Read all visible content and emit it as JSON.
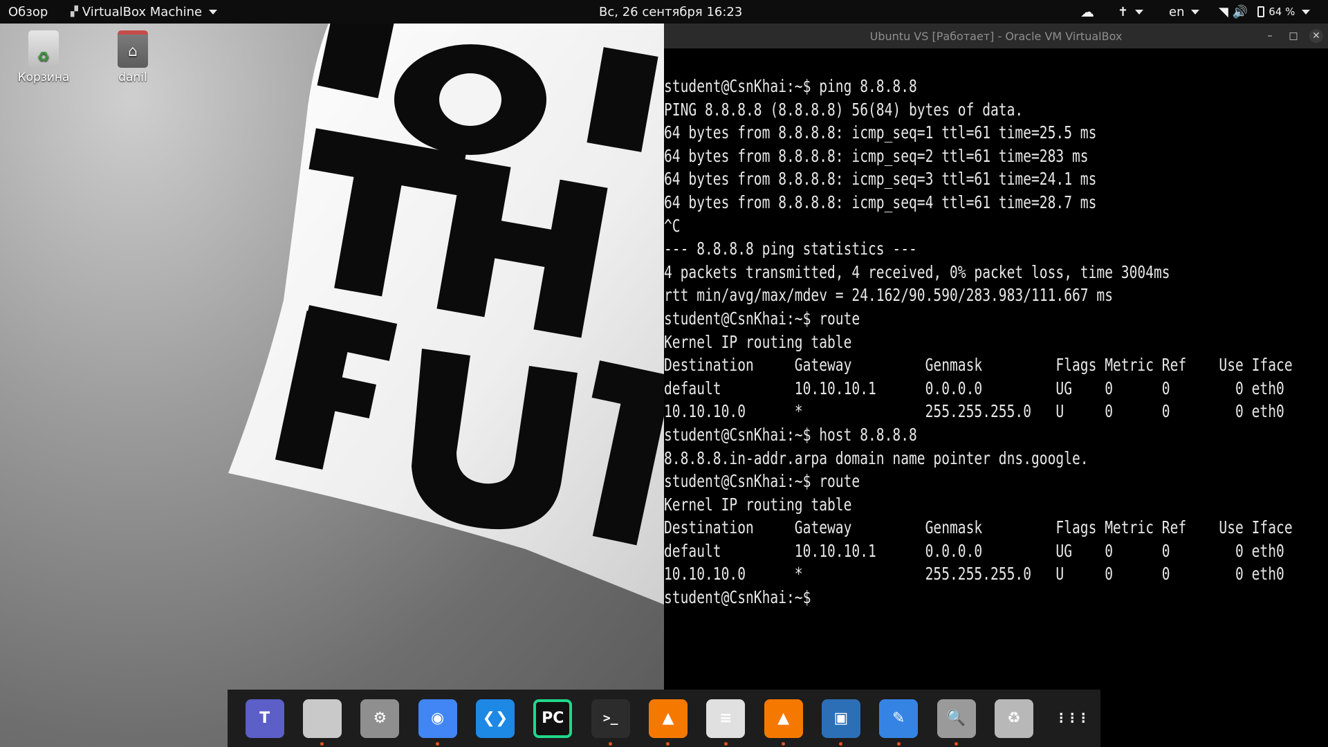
{
  "topbar": {
    "activities": "Обзор",
    "app_menu": "VirtualBox Machine",
    "clock": "Вс, 26 сентября  16:23",
    "language": "en",
    "battery": "64 %"
  },
  "desktop": {
    "icons": [
      {
        "label": "Корзина",
        "icon": "trash-icon"
      },
      {
        "label": "danil",
        "icon": "home-folder-icon"
      }
    ]
  },
  "vbox": {
    "title": "Ubuntu VS [Работает] - Oracle VM VirtualBox"
  },
  "terminal": {
    "lines": [
      "student@CsnKhai:~$ ping 8.8.8.8",
      "PING 8.8.8.8 (8.8.8.8) 56(84) bytes of data.",
      "64 bytes from 8.8.8.8: icmp_seq=1 ttl=61 time=25.5 ms",
      "64 bytes from 8.8.8.8: icmp_seq=2 ttl=61 time=283 ms",
      "64 bytes from 8.8.8.8: icmp_seq=3 ttl=61 time=24.1 ms",
      "64 bytes from 8.8.8.8: icmp_seq=4 ttl=61 time=28.7 ms",
      "^C",
      "--- 8.8.8.8 ping statistics ---",
      "4 packets transmitted, 4 received, 0% packet loss, time 3004ms",
      "rtt min/avg/max/mdev = 24.162/90.590/283.983/111.667 ms",
      "student@CsnKhai:~$ route",
      "Kernel IP routing table",
      "Destination     Gateway         Genmask         Flags Metric Ref    Use Iface",
      "default         10.10.10.1      0.0.0.0         UG    0      0        0 eth0",
      "10.10.10.0      *               255.255.255.0   U     0      0        0 eth0",
      "student@CsnKhai:~$ host 8.8.8.8",
      "8.8.8.8.in-addr.arpa domain name pointer dns.google.",
      "student@CsnKhai:~$ route",
      "Kernel IP routing table",
      "Destination     Gateway         Genmask         Flags Metric Ref    Use Iface",
      "default         10.10.10.1      0.0.0.0         UG    0      0        0 eth0",
      "10.10.10.0      *               255.255.255.0   U     0      0        0 eth0",
      "student@CsnKhai:~$"
    ]
  },
  "dock": {
    "items": [
      {
        "name": "teams-icon",
        "glyph": "T",
        "color": "#5b5fc7",
        "running": false
      },
      {
        "name": "files-icon",
        "glyph": "",
        "color": "#c9c9c9",
        "running": true
      },
      {
        "name": "settings-icon",
        "glyph": "⚙",
        "color": "#8f8f8f",
        "running": false
      },
      {
        "name": "chrome-icon",
        "glyph": "◉",
        "color": "#4285f4",
        "running": true
      },
      {
        "name": "vscode-icon",
        "glyph": "❮❯",
        "color": "#1e88e5",
        "running": false
      },
      {
        "name": "pycharm-icon",
        "glyph": "PC",
        "color": "#21d789",
        "running": false
      },
      {
        "name": "terminal-icon",
        "glyph": ">_",
        "color": "#2c2c2c",
        "running": true
      },
      {
        "name": "presentation-icon",
        "glyph": "▲",
        "color": "#f57900",
        "running": true
      },
      {
        "name": "document-viewer-icon",
        "glyph": "≡",
        "color": "#e0e0e0",
        "running": true
      },
      {
        "name": "impress-icon",
        "glyph": "▲",
        "color": "#f57900",
        "running": true
      },
      {
        "name": "virtualbox-icon",
        "glyph": "▣",
        "color": "#2d6fb7",
        "running": true
      },
      {
        "name": "text-editor-icon",
        "glyph": "✎",
        "color": "#3584e4",
        "running": true
      },
      {
        "name": "image-viewer-icon",
        "glyph": "🔍",
        "color": "#9a9a9a",
        "running": true
      },
      {
        "name": "trash-dock-icon",
        "glyph": "♻",
        "color": "#b8b8b8",
        "running": false
      },
      {
        "name": "app-grid-icon",
        "glyph": "⋮⋮⋮",
        "color": "#1d1d1d",
        "running": false
      }
    ]
  }
}
